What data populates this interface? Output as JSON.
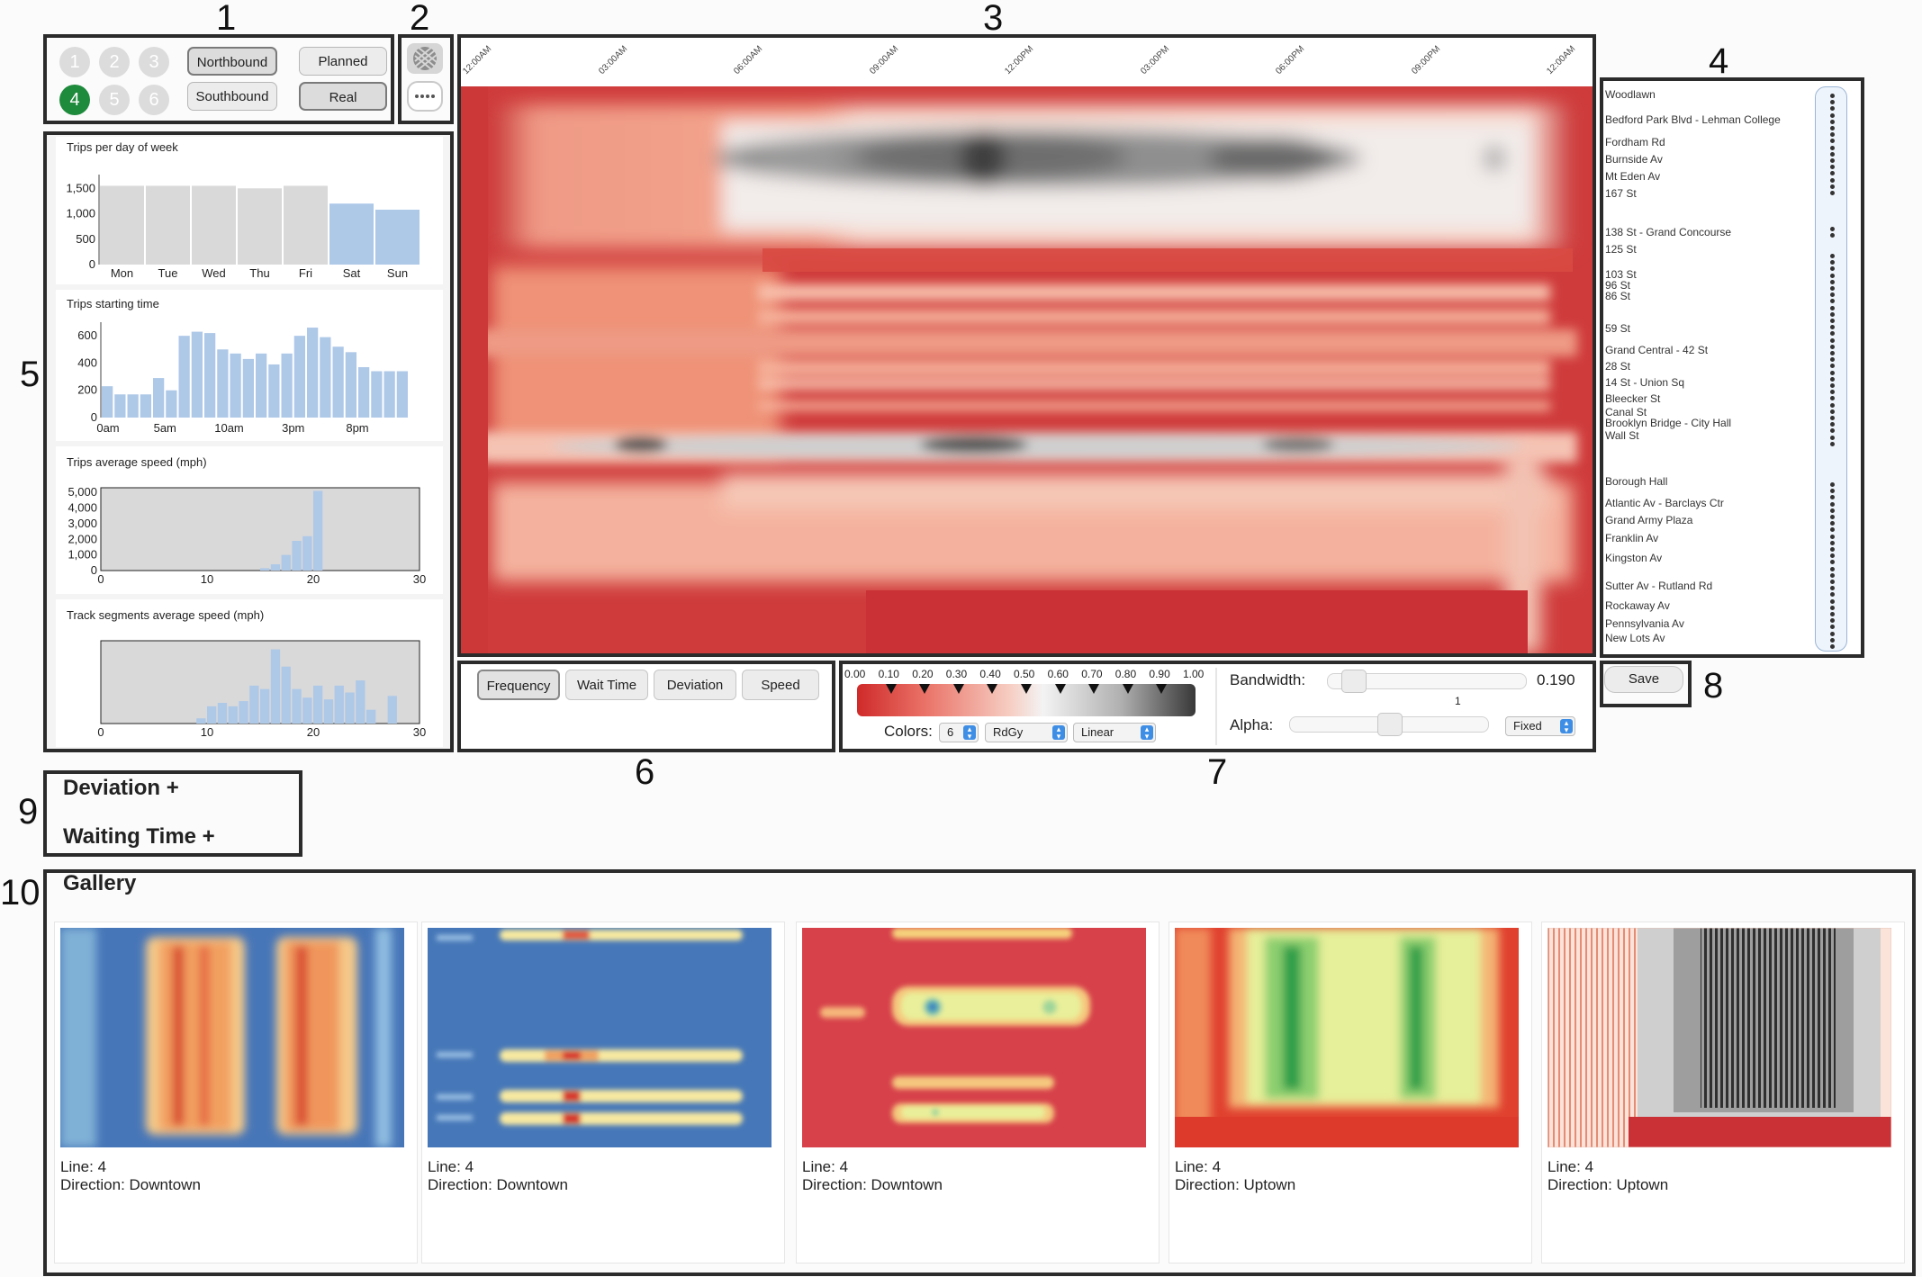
{
  "section_numbers": [
    "1",
    "2",
    "3",
    "4",
    "5",
    "6",
    "7",
    "8",
    "9",
    "10"
  ],
  "panel1": {
    "line_circles": [
      "1",
      "2",
      "3",
      "4",
      "5",
      "6"
    ],
    "active_line": "4",
    "direction_buttons": [
      "Northbound",
      "Southbound"
    ],
    "mode_buttons": [
      "Planned",
      "Real"
    ]
  },
  "panel3": {
    "time_labels": [
      "12:00AM",
      "03:00AM",
      "06:00AM",
      "09:00AM",
      "12:00PM",
      "03:00PM",
      "06:00PM",
      "09:00PM",
      "12:00AM"
    ]
  },
  "stations": [
    "Woodlawn",
    "Bedford Park Blvd - Lehman College",
    "Fordham Rd",
    "Burnside Av",
    "Mt Eden Av",
    "167 St",
    "138 St - Grand Concourse",
    "125 St",
    "103 St",
    "96 St",
    "86 St",
    "59 St",
    "Grand Central - 42 St",
    "28 St",
    "14 St - Union Sq",
    "Bleecker St",
    "Canal St",
    "Brooklyn Bridge - City Hall",
    "Wall St",
    "Borough Hall",
    "Atlantic Av - Barclays Ctr",
    "Grand Army Plaza",
    "Franklin Av",
    "Kingston Av",
    "Sutter Av - Rutland Rd",
    "Rockaway Av",
    "Pennsylvania Av",
    "New Lots Av"
  ],
  "charts": {
    "trips_per_day": {
      "title": "Trips per day of week",
      "categories": [
        "Mon",
        "Tue",
        "Wed",
        "Thu",
        "Fri",
        "Sat",
        "Sun"
      ],
      "y_ticks": [
        "1,500",
        "1,000",
        "500",
        "0"
      ]
    },
    "trips_start": {
      "title": "Trips starting time",
      "x_ticks": [
        "0am",
        "5am",
        "10am",
        "3pm",
        "8pm"
      ],
      "y_ticks": [
        "600",
        "400",
        "200",
        "0"
      ]
    },
    "avg_speed": {
      "title": "Trips average speed (mph)",
      "x_ticks": [
        "0",
        "10",
        "20",
        "30"
      ],
      "y_ticks": [
        "5,000",
        "4,000",
        "3,000",
        "2,000",
        "1,000",
        "0"
      ]
    },
    "seg_speed": {
      "title": "Track segments average speed (mph)",
      "x_ticks": [
        "0",
        "10",
        "20",
        "30"
      ]
    }
  },
  "chart_data": [
    {
      "type": "bar",
      "title": "Trips per day of week",
      "categories": [
        "Mon",
        "Tue",
        "Wed",
        "Thu",
        "Fri",
        "Sat",
        "Sun"
      ],
      "values": [
        1550,
        1550,
        1550,
        1500,
        1550,
        1200,
        1080
      ],
      "ylim": [
        0,
        1700
      ],
      "colors": [
        "#d9d9d9",
        "#d9d9d9",
        "#d9d9d9",
        "#d9d9d9",
        "#d9d9d9",
        "#aec8e8",
        "#aec8e8"
      ]
    },
    {
      "type": "bar",
      "title": "Trips starting time",
      "x": [
        0,
        1,
        2,
        3,
        4,
        5,
        6,
        7,
        8,
        9,
        10,
        11,
        12,
        13,
        14,
        15,
        16,
        17,
        18,
        19,
        20,
        21,
        22,
        23
      ],
      "values": [
        230,
        170,
        170,
        170,
        290,
        200,
        600,
        630,
        620,
        500,
        470,
        430,
        470,
        390,
        470,
        600,
        660,
        590,
        520,
        480,
        370,
        340,
        340,
        340
      ],
      "ylim": [
        0,
        700
      ]
    },
    {
      "type": "bar",
      "title": "Trips average speed (mph)",
      "x": [
        15,
        16,
        17,
        18,
        19,
        20
      ],
      "values": [
        150,
        400,
        1000,
        1900,
        2200,
        5100
      ],
      "xlim": [
        0,
        30
      ],
      "ylim": [
        0,
        5300
      ]
    },
    {
      "type": "bar",
      "title": "Track segments average speed (mph)",
      "x": [
        9,
        10,
        11,
        12,
        13,
        14,
        15,
        16,
        17,
        18,
        19,
        20,
        21,
        22,
        23,
        24,
        25,
        27
      ],
      "values": [
        3,
        10,
        12,
        10,
        13,
        22,
        20,
        43,
        33,
        20,
        15,
        22,
        14,
        22,
        18,
        25,
        8,
        16
      ],
      "xlim": [
        0,
        30
      ],
      "ylim": [
        0,
        48
      ]
    }
  ],
  "panel6": {
    "buttons": [
      "Frequency",
      "Wait Time",
      "Deviation",
      "Speed"
    ],
    "selected": "Frequency"
  },
  "panel7": {
    "scale_ticks": [
      "0.00",
      "0.10",
      "0.20",
      "0.30",
      "0.40",
      "0.50",
      "0.60",
      "0.70",
      "0.80",
      "0.90",
      "1.00"
    ],
    "colors_label": "Colors:",
    "colors_count": "6",
    "scheme": "RdGy",
    "scale_type": "Linear",
    "bandwidth_label": "Bandwidth:",
    "bandwidth_value": "0.190",
    "bandwidth_step": "1",
    "alpha_label": "Alpha:",
    "alpha_mode": "Fixed"
  },
  "panel8": {
    "save_label": "Save"
  },
  "panel9": {
    "items": [
      "Deviation +",
      "Waiting Time +"
    ]
  },
  "gallery": {
    "title": "Gallery",
    "items": [
      {
        "line": "Line: 4",
        "direction": "Direction: Downtown"
      },
      {
        "line": "Line: 4",
        "direction": "Direction: Downtown"
      },
      {
        "line": "Line: 4",
        "direction": "Direction: Downtown"
      },
      {
        "line": "Line: 4",
        "direction": "Direction: Uptown"
      },
      {
        "line": "Line: 4",
        "direction": "Direction: Uptown"
      }
    ]
  }
}
